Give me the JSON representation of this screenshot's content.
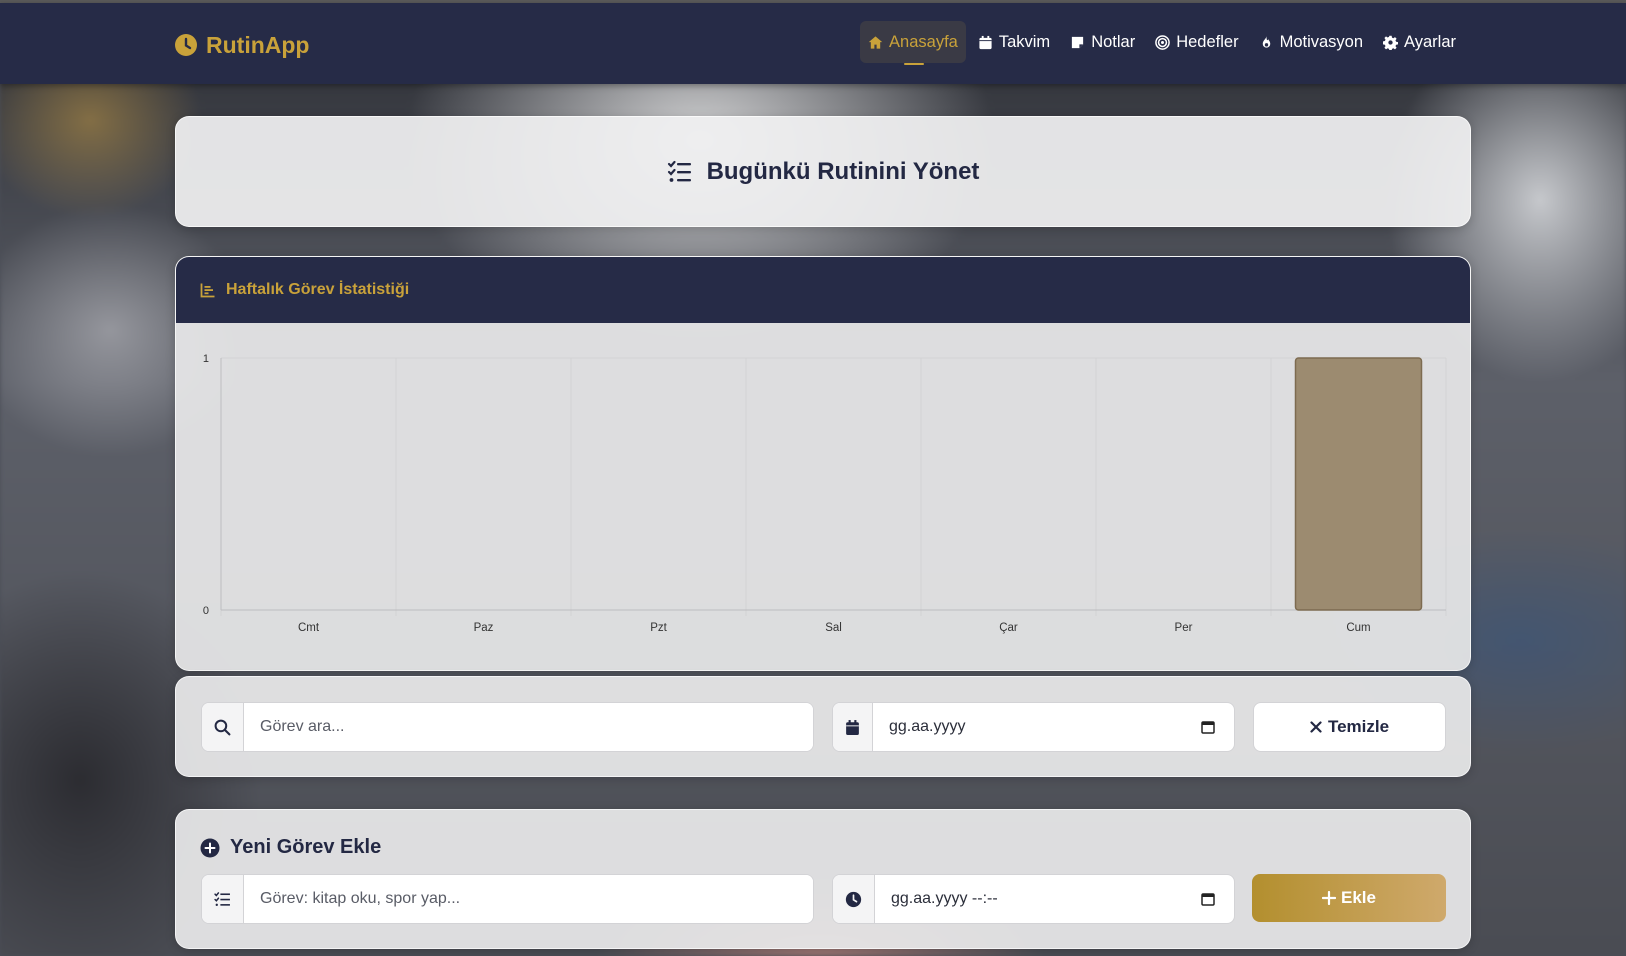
{
  "app": {
    "brand": "RutinApp",
    "brand_icon": "clock-icon",
    "accent_color": "#c9a23a",
    "navbar_color": "#262b47"
  },
  "nav": {
    "items": [
      {
        "label": "Anasayfa",
        "icon": "home-icon",
        "active": true
      },
      {
        "label": "Takvim",
        "icon": "calendar-icon",
        "active": false
      },
      {
        "label": "Notlar",
        "icon": "note-icon",
        "active": false
      },
      {
        "label": "Hedefler",
        "icon": "target-icon",
        "active": false
      },
      {
        "label": "Motivasyon",
        "icon": "fire-icon",
        "active": false
      },
      {
        "label": "Ayarlar",
        "icon": "gear-icon",
        "active": false
      }
    ]
  },
  "header": {
    "title": "Bugünkü Rutinini Yönet",
    "icon": "list-check-icon"
  },
  "stats": {
    "title": "Haftalık Görev İstatistiği",
    "icon": "bar-chart-icon"
  },
  "chart_data": {
    "type": "bar",
    "categories": [
      "Cmt",
      "Paz",
      "Pzt",
      "Sal",
      "Çar",
      "Per",
      "Cum"
    ],
    "values": [
      0,
      0,
      0,
      0,
      0,
      0,
      1
    ],
    "ylim": [
      0,
      1
    ],
    "yticks": [
      0,
      1
    ],
    "grid": true,
    "bar_color": "#9c8b70",
    "bar_border": "#7d6b50"
  },
  "filter": {
    "search_placeholder": "Görev ara...",
    "date_placeholder": "gg.aa.yyyy",
    "clear_label": "Temizle"
  },
  "add_task": {
    "title": "Yeni Görev Ekle",
    "task_placeholder": "Görev: kitap oku, spor yap...",
    "datetime_placeholder": "gg.aa.yyyy --:--",
    "add_label": "Ekle"
  }
}
